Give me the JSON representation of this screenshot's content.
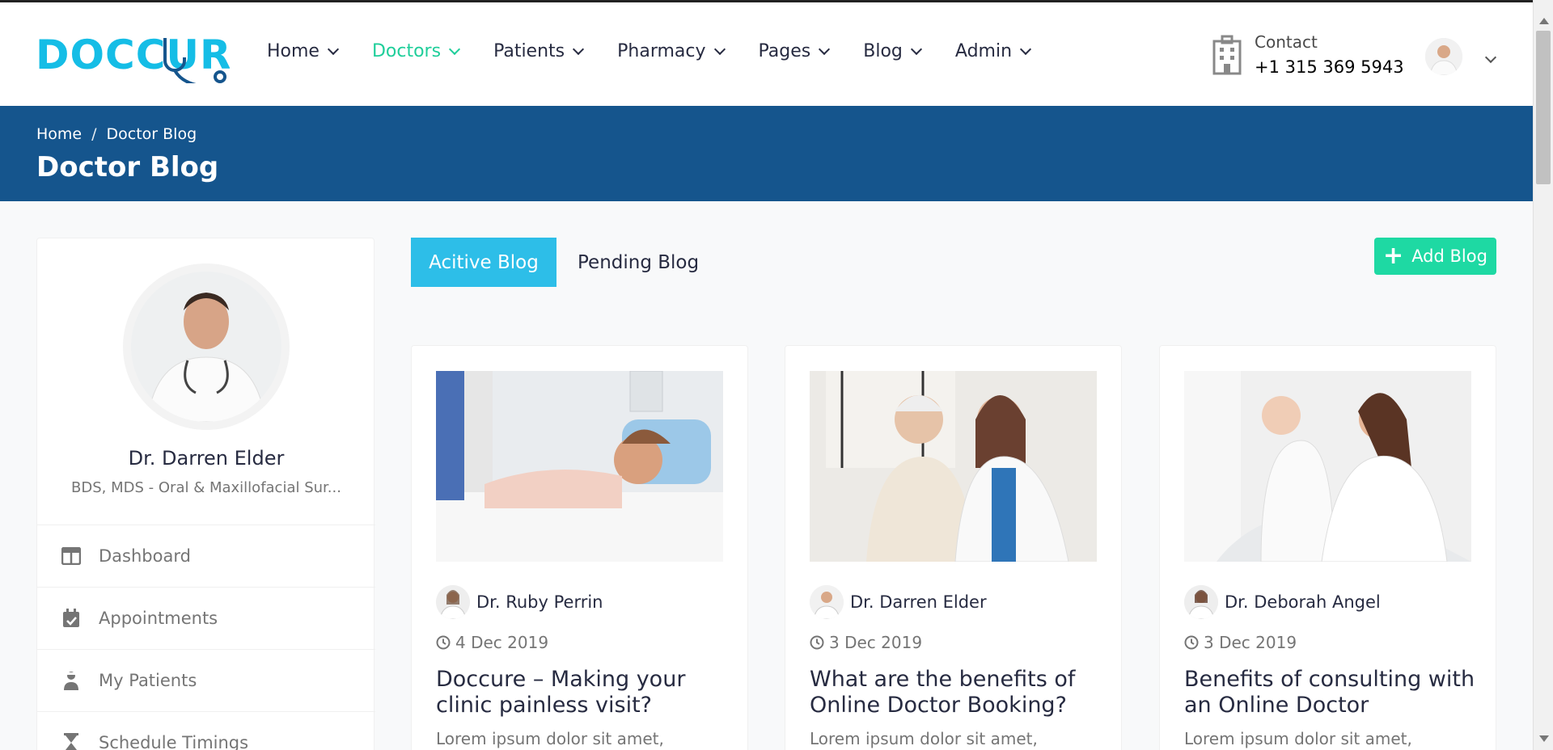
{
  "header": {
    "logo_text": "DOCCURE",
    "nav": [
      {
        "label": "Home",
        "active": false
      },
      {
        "label": "Doctors",
        "active": true
      },
      {
        "label": "Patients",
        "active": false
      },
      {
        "label": "Pharmacy",
        "active": false
      },
      {
        "label": "Pages",
        "active": false
      },
      {
        "label": "Blog",
        "active": false
      },
      {
        "label": "Admin",
        "active": false
      }
    ],
    "contact_label": "Contact",
    "contact_number": "+1 315 369 5943"
  },
  "breadcrumb": {
    "home": "Home",
    "separator": "/",
    "current": "Doctor Blog",
    "page_title": "Doctor Blog"
  },
  "sidebar": {
    "doctor_name": "Dr. Darren Elder",
    "specialty": "BDS, MDS - Oral & Maxillofacial Sur...",
    "menu": [
      {
        "label": "Dashboard",
        "icon": "columns-icon"
      },
      {
        "label": "Appointments",
        "icon": "calendar-check-icon"
      },
      {
        "label": "My Patients",
        "icon": "user-injured-icon"
      },
      {
        "label": "Schedule Timings",
        "icon": "hourglass-icon"
      }
    ]
  },
  "tabs": {
    "active_label": "Acitive Blog",
    "pending_label": "Pending Blog"
  },
  "add_blog_label": "Add Blog",
  "blogs": [
    {
      "author": "Dr. Ruby Perrin",
      "date": "4 Dec 2019",
      "title": "Doccure – Making your clinic painless visit?",
      "excerpt": "Lorem ipsum dolor sit amet,"
    },
    {
      "author": "Dr. Darren Elder",
      "date": "3 Dec 2019",
      "title": "What are the benefits of Online Doctor Booking?",
      "excerpt": "Lorem ipsum dolor sit amet,"
    },
    {
      "author": "Dr. Deborah Angel",
      "date": "3 Dec 2019",
      "title": "Benefits of consulting with an Online Doctor",
      "excerpt": "Lorem ipsum dolor sit amet,"
    }
  ],
  "colors": {
    "brand": "#15bde6",
    "active_nav": "#1fce9a",
    "crumb_bg": "#15558d",
    "tab_active": "#2dbee8",
    "add_button": "#1ed9a3"
  }
}
